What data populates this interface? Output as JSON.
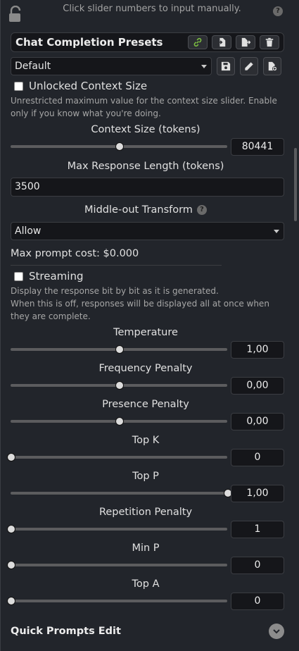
{
  "top_hint": "Click slider numbers to input manually.",
  "presets": {
    "title": "Chat Completion Presets",
    "selected": "Default"
  },
  "unlocked_context": {
    "label": "Unlocked Context Size",
    "description": "Unrestricted maximum value for the context size slider. Enable only if you know what you're doing.",
    "checked": false
  },
  "context_size": {
    "label": "Context Size (tokens)",
    "value": "80441"
  },
  "max_response": {
    "label": "Max Response Length (tokens)",
    "value": "3500"
  },
  "middle_out": {
    "label": "Middle-out Transform",
    "selected": "Allow"
  },
  "max_prompt_cost": "Max prompt cost: $0.000",
  "streaming": {
    "label": "Streaming",
    "description_line1": "Display the response bit by bit as it is generated.",
    "description_line2": "When this is off, responses will be displayed all at once when they are complete.",
    "checked": false
  },
  "sliders": [
    {
      "label": "Temperature",
      "value": "1,00",
      "fraction": 0.5
    },
    {
      "label": "Frequency Penalty",
      "value": "0,00",
      "fraction": 0.5
    },
    {
      "label": "Presence Penalty",
      "value": "0,00",
      "fraction": 0.5
    },
    {
      "label": "Top K",
      "value": "0",
      "fraction": 0.0
    },
    {
      "label": "Top P",
      "value": "1,00",
      "fraction": 1.0
    },
    {
      "label": "Repetition Penalty",
      "value": "1",
      "fraction": 0.0
    },
    {
      "label": "Min P",
      "value": "0",
      "fraction": 0.0
    },
    {
      "label": "Top A",
      "value": "0",
      "fraction": 0.0
    }
  ],
  "context_slider_fraction": 0.5,
  "quick_prompts": "Quick Prompts Edit",
  "colors": {
    "accent_green": "#7dc042",
    "panel_bg": "#22252b",
    "input_bg": "#15161a"
  }
}
